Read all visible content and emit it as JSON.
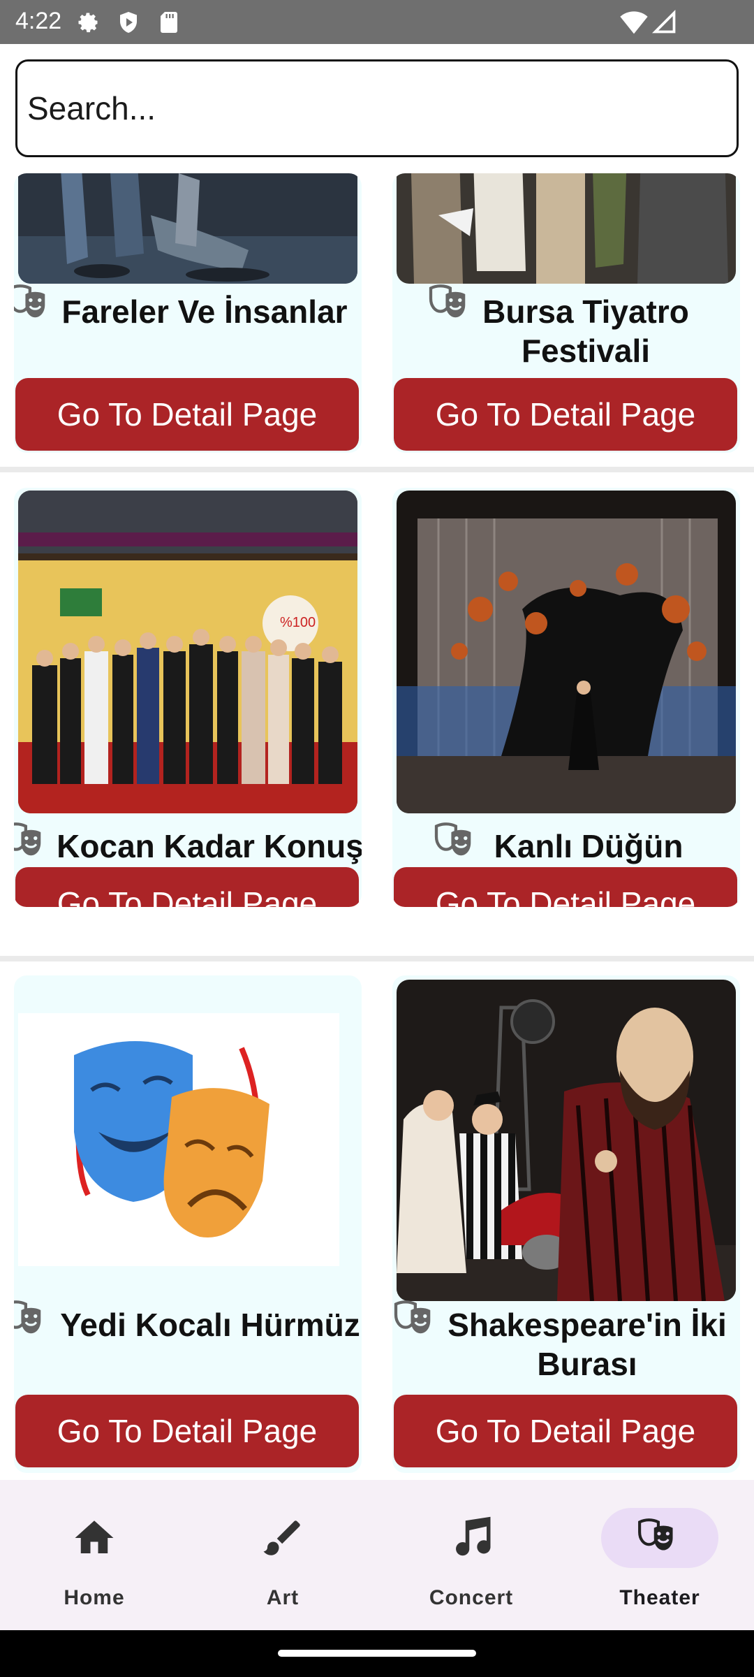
{
  "status_bar": {
    "time": "4:22"
  },
  "search": {
    "placeholder": "Search..."
  },
  "cards": [
    {
      "title_lines": [
        "Fareler Ve İnsanlar"
      ],
      "button_label": "Go To Detail Page"
    },
    {
      "title_lines": [
        "Bursa Tiyatro",
        "Festivali"
      ],
      "button_label": "Go To Detail Page"
    },
    {
      "title_lines": [
        "Kocan Kadar Konuş"
      ],
      "button_label": "Go To Detail Page"
    },
    {
      "title_lines": [
        "Kanlı Düğün"
      ],
      "button_label": "Go To Detail Page"
    },
    {
      "title_lines": [
        "Yedi Kocalı Hürmüz"
      ],
      "button_label": "Go To Detail Page"
    },
    {
      "title_lines": [
        "Shakespeare'in İki",
        "Burası"
      ],
      "button_label": "Go To Detail Page"
    }
  ],
  "bottom_nav": {
    "items": [
      {
        "label": "Home",
        "icon": "home-icon"
      },
      {
        "label": "Art",
        "icon": "brush-icon"
      },
      {
        "label": "Concert",
        "icon": "music-note-icon"
      },
      {
        "label": "Theater",
        "icon": "theater-masks-icon"
      }
    ],
    "active": "Theater"
  },
  "colors": {
    "accent_button": "#ab2427",
    "card_background": "#effdfe",
    "nav_background": "#f6f0f7",
    "nav_active_pill": "#eadcf6",
    "status_bar": "#6f6f6f"
  }
}
